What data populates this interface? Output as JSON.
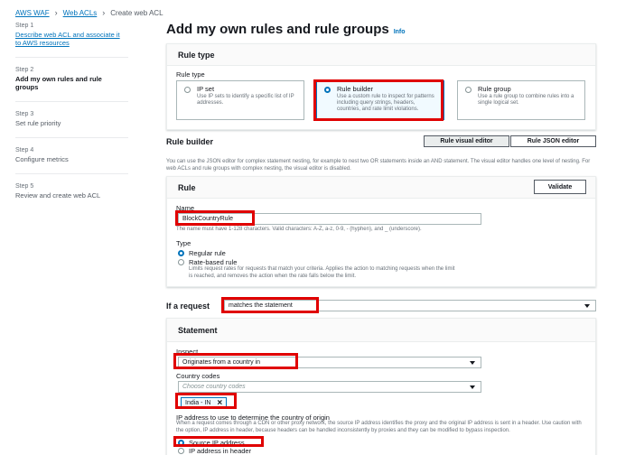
{
  "breadcrumb": {
    "items": [
      "AWS WAF",
      "Web ACLs"
    ],
    "current": "Create web ACL",
    "separator": "›"
  },
  "steps": [
    {
      "number": "Step 1",
      "title": "Describe web ACL and associate it to AWS resources"
    },
    {
      "number": "Step 2",
      "title": "Add my own rules and rule groups"
    },
    {
      "number": "Step 3",
      "title": "Set rule priority"
    },
    {
      "number": "Step 4",
      "title": "Configure metrics"
    },
    {
      "number": "Step 5",
      "title": "Review and create web ACL"
    }
  ],
  "page": {
    "title": "Add my own rules and rule groups",
    "info": "Info"
  },
  "rule_type": {
    "header": "Rule type",
    "label": "Rule type",
    "options": [
      {
        "title": "IP set",
        "desc": "Use IP sets to identify a specific list of IP addresses."
      },
      {
        "title": "Rule builder",
        "desc": "Use a custom rule to inspect for patterns including query strings, headers, countries, and rate limit violations."
      },
      {
        "title": "Rule group",
        "desc": "Use a rule group to combine rules into a single logical set."
      }
    ]
  },
  "rule_builder": {
    "title": "Rule builder",
    "visual_tab": "Rule visual editor",
    "json_tab": "Rule JSON editor",
    "description": "You can use the JSON editor for complex statement nesting, for example to nest two OR statements inside an AND statement. The visual editor handles one level of nesting. For web ACLs and rule groups with complex nesting, the visual editor is disabled."
  },
  "rule": {
    "header": "Rule",
    "validate": "Validate",
    "name_label": "Name",
    "name_value": "BlockCountryRule",
    "name_hint": "The name must have 1-128 characters. Valid characters: A-Z, a-z, 0-9, - (hyphen), and _ (underscore).",
    "type_label": "Type",
    "regular": "Regular rule",
    "rate_based": "Rate-based rule",
    "rate_desc": "Limits request rates for requests that match your criteria. Applies the action to matching requests when the limit is reached, and removes the action when the rate falls below the limit."
  },
  "request": {
    "label": "If a request",
    "value": "matches the statement"
  },
  "statement": {
    "header": "Statement",
    "inspect_label": "Inspect",
    "inspect_value": "Originates from a country in",
    "country_label": "Country codes",
    "country_placeholder": "Choose country codes",
    "token": "India - IN",
    "ip_label": "IP address to use to determine the country of origin",
    "ip_desc": "When a request comes through a CDN or other proxy network, the source IP address identifies the proxy and the original IP address is sent in a header. Use caution with the option, IP address in header, because headers can be handled inconsistently by proxies and they can be modified to bypass inspection.",
    "source_ip": "Source IP address",
    "header_ip": "IP address in header"
  },
  "colors": {
    "link": "#0073bb",
    "highlight": "#e00000",
    "selected": "#0073bb"
  }
}
